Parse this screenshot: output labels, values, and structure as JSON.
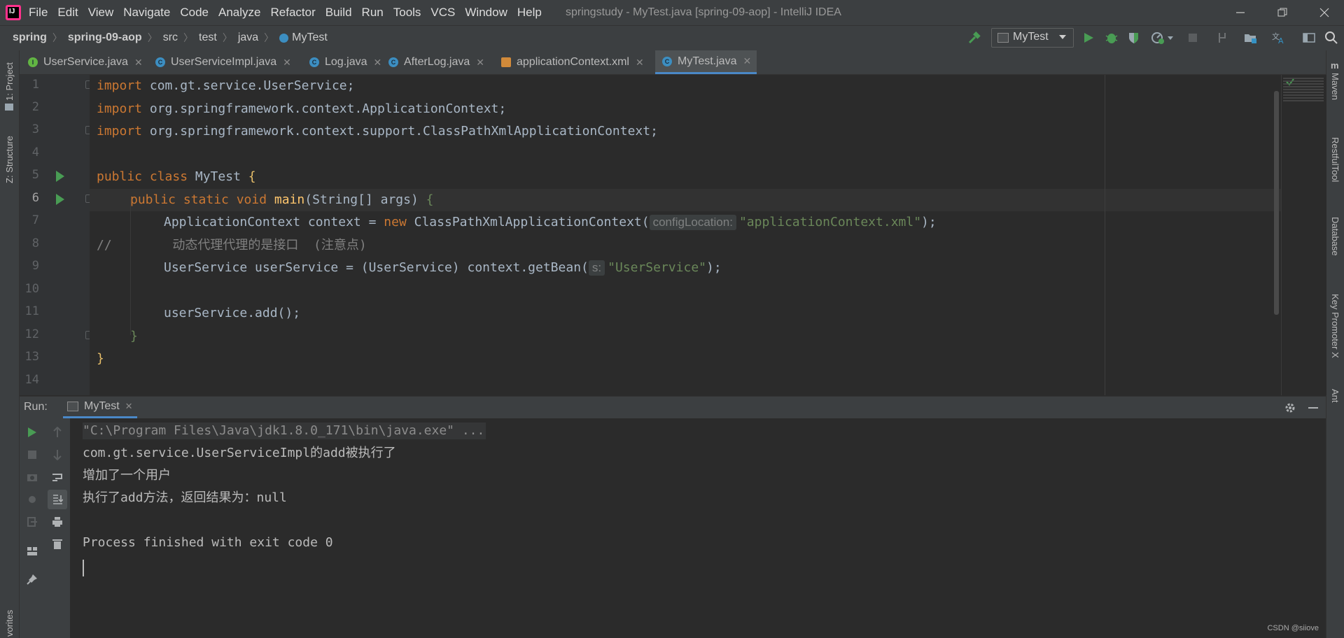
{
  "menu": {
    "items": [
      "File",
      "Edit",
      "View",
      "Navigate",
      "Code",
      "Analyze",
      "Refactor",
      "Build",
      "Run",
      "Tools",
      "VCS",
      "Window",
      "Help"
    ],
    "window_title": "springstudy - MyTest.java [spring-09-aop] - IntelliJ IDEA"
  },
  "breadcrumb": [
    "spring",
    "spring-09-aop",
    "src",
    "test",
    "java",
    "MyTest"
  ],
  "toolbar": {
    "run_config": "MyTest"
  },
  "tabs": [
    {
      "label": "UserService.java",
      "icon": "interface-icon",
      "active": false
    },
    {
      "label": "UserServiceImpl.java",
      "icon": "class-icon",
      "active": false
    },
    {
      "label": "Log.java",
      "icon": "class-icon",
      "active": false
    },
    {
      "label": "AfterLog.java",
      "icon": "class-icon",
      "active": false
    },
    {
      "label": "applicationContext.xml",
      "icon": "xml-icon",
      "active": false
    },
    {
      "label": "MyTest.java",
      "icon": "class-icon",
      "active": true
    }
  ],
  "left_strip": {
    "project": "1: Project",
    "structure": "Z: Structure",
    "favorites": "vorites"
  },
  "right_strip": {
    "maven": "Maven",
    "restful": "RestfulTool",
    "database": "Database",
    "keypromoter": "Key Promoter X",
    "ant": "Ant"
  },
  "editor": {
    "line_numbers": [
      "1",
      "2",
      "3",
      "4",
      "5",
      "6",
      "7",
      "8",
      "9",
      "10",
      "11",
      "12",
      "13",
      "14"
    ],
    "code": {
      "l1_kw": "import",
      "l1_rest": " com.gt.service.UserService;",
      "l2_kw": "import",
      "l2_rest": " org.springframework.context.ApplicationContext;",
      "l3_kw": "import",
      "l3_rest": " org.springframework.context.support.ClassPathXmlApplicationContext;",
      "l5_kw": "public class",
      "l5_name": " MyTest ",
      "l5_brace": "{",
      "l6_kw": "public static void",
      "l6_fn": " main",
      "l6_rest": "(String[] args) ",
      "l6_brace": "{",
      "l7_a": "ApplicationContext context = ",
      "l7_new": "new",
      "l7_b": " ClassPathXmlApplicationContext(",
      "l7_hint": "configLocation:",
      "l7_str": "\"applicationContext.xml\"",
      "l7_end": ");",
      "l8_comment": "//        动态代理代理的是接口  (注意点)",
      "l9_a": "UserService userService = (UserService) context.getBean(",
      "l9_hint": "s:",
      "l9_str": "\"UserService\"",
      "l9_end": ");",
      "l11": "userService.add();",
      "l12": "}",
      "l13": "}"
    }
  },
  "run_panel": {
    "label": "Run:",
    "tab": "MyTest",
    "console": [
      "\"C:\\Program Files\\Java\\jdk1.8.0_171\\bin\\java.exe\" ...",
      "com.gt.service.UserServiceImpl的add被执行了",
      "增加了一个用户",
      "执行了add方法，返回结果为：null",
      "",
      "Process finished with exit code 0"
    ]
  },
  "watermark": "CSDN @siiove",
  "colors": {
    "accent": "#4a88c7",
    "run_green": "#499c54",
    "keyword": "#cc7832",
    "string": "#6a8759"
  }
}
